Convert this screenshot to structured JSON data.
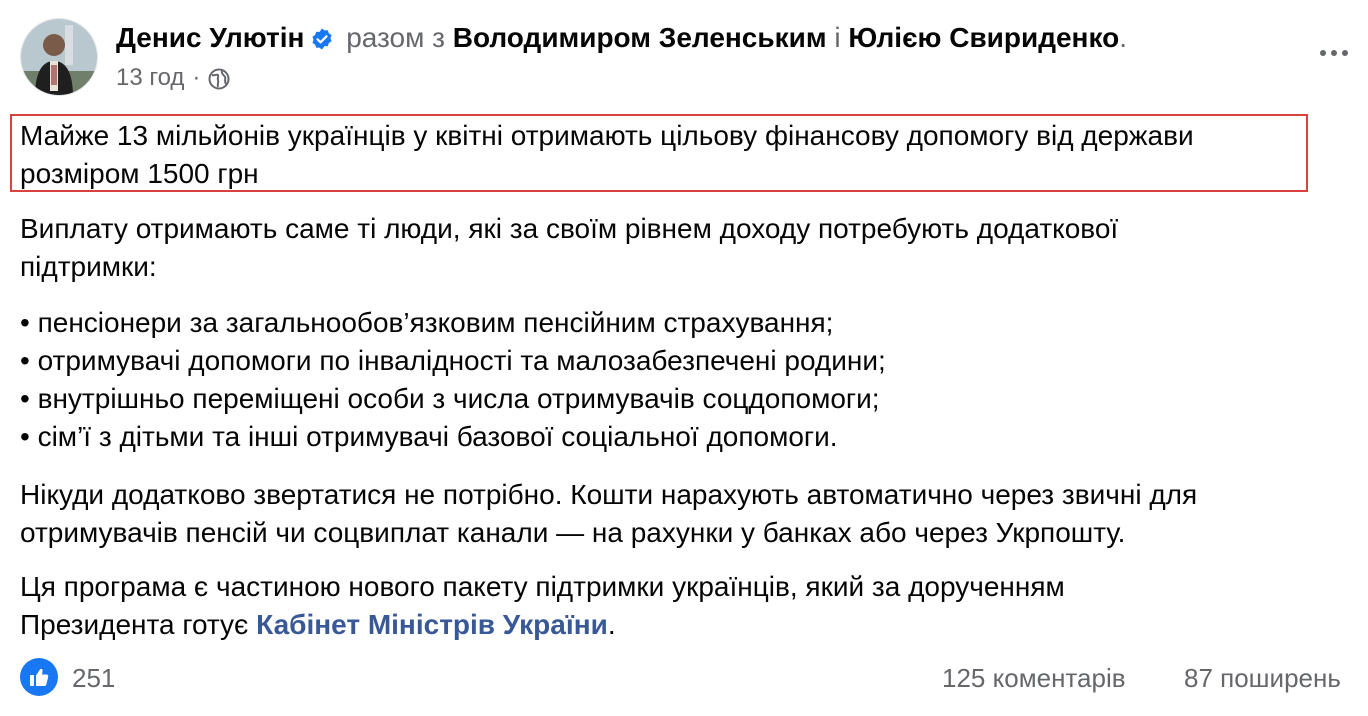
{
  "post": {
    "author": "Денис Улютін",
    "with_word": "разом з",
    "tagged_1": "Володимиром Зеленським",
    "and_word": "і",
    "tagged_2": "Юлією Свириденко",
    "period": ".",
    "time": "13 год",
    "separator": "·",
    "headline_line1": "Майже 13 мільйонів українців у квітні отримають цільову фінансову допомогу від держави",
    "headline_line2": "розміром 1500 грн",
    "para1_line1": "Виплату отримають саме ті люди, які за своїм рівнем доходу потребують додаткової",
    "para1_line2": "підтримки:",
    "bullets": [
      "• пенсіонери за загальнообов’язковим пенсійним страхування;",
      "• отримувачі допомоги по інвалідності та малозабезпечені родини;",
      "• внутрішньо переміщені особи з числа отримувачів соцдопомоги;",
      "• сім’ї з дітьми та інші отримувачі базової соціальної допомоги."
    ],
    "para2_line1": "Нікуди додатково звертатися не потрібно. Кошти нарахують автоматично через звичні для",
    "para2_line2": "отримувачів пенсій чи соцвиплат канали — на рахунки у банках або через Укрпошту.",
    "para3_line1": "Ця програма є частиною нового пакету підтримки українців, який за  дорученням",
    "para3_line2_prefix": "Президента готує ",
    "para3_link": "Кабінет Міністрів України",
    "para3_line2_suffix": "."
  },
  "footer": {
    "likes": "251",
    "comments": "125 коментарів",
    "shares": "87 поширень"
  },
  "icons": {
    "verified": "verified-badge-icon",
    "globe": "globe-icon",
    "more": "more-options-icon",
    "like": "like-icon"
  },
  "colors": {
    "link": "#385898",
    "highlight_border": "#d9433b",
    "verified": "#1877f2",
    "muted": "#65676b"
  }
}
